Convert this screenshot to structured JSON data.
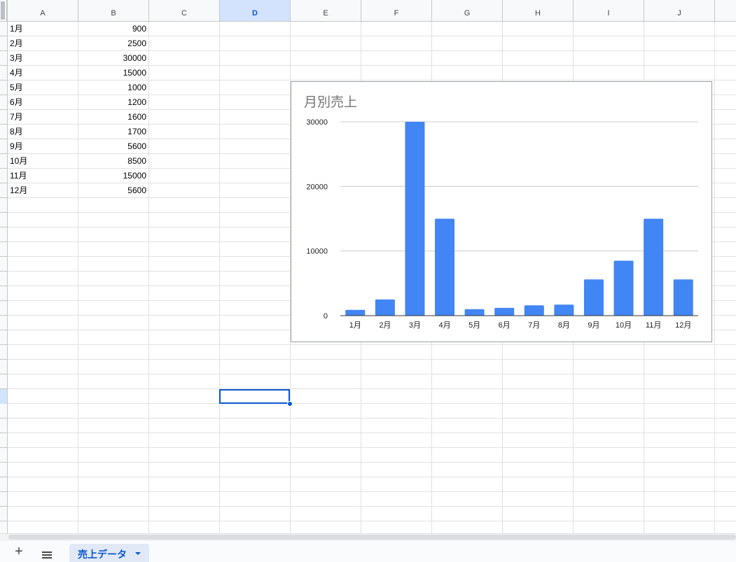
{
  "sheet": {
    "column_headers": [
      "A",
      "B",
      "C",
      "D",
      "E",
      "F",
      "G",
      "H",
      "I",
      "J"
    ],
    "selected_column": "D",
    "rows": [
      {
        "a": "1月",
        "b": "900"
      },
      {
        "a": "2月",
        "b": "2500"
      },
      {
        "a": "3月",
        "b": "30000"
      },
      {
        "a": "4月",
        "b": "15000"
      },
      {
        "a": "5月",
        "b": "1000"
      },
      {
        "a": "6月",
        "b": "1200"
      },
      {
        "a": "7月",
        "b": "1600"
      },
      {
        "a": "8月",
        "b": "1700"
      },
      {
        "a": "9月",
        "b": "5600"
      },
      {
        "a": "10月",
        "b": "8500"
      },
      {
        "a": "11月",
        "b": "15000"
      },
      {
        "a": "12月",
        "b": "5600"
      }
    ]
  },
  "chart_data": {
    "type": "bar",
    "title": "月別売上",
    "categories": [
      "1月",
      "2月",
      "3月",
      "4月",
      "5月",
      "6月",
      "7月",
      "8月",
      "9月",
      "10月",
      "11月",
      "12月"
    ],
    "values": [
      900,
      2500,
      30000,
      15000,
      1000,
      1200,
      1600,
      1700,
      5600,
      8500,
      15000,
      5600
    ],
    "yticks": [
      "0",
      "10000",
      "20000",
      "30000"
    ],
    "ylim": [
      0,
      30000
    ],
    "grid": true,
    "bar_color": "#4285f4",
    "xlabel": "",
    "ylabel": ""
  },
  "bottom_bar": {
    "add_icon": "plus-icon",
    "list_icon": "menu-icon",
    "tab_label": "売上データ",
    "tab_dropdown_icon": "caret-down-icon"
  },
  "colors": {
    "accent": "#0b57d0",
    "selected_header_bg": "#d3e3fd",
    "gridline": "#e1e1e1"
  }
}
